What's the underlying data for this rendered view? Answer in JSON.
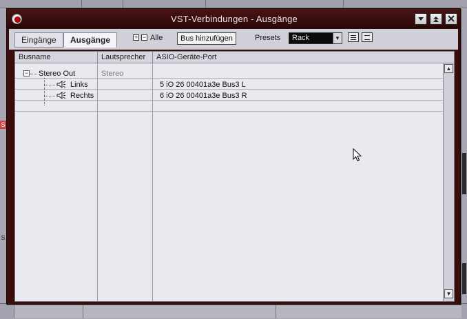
{
  "window": {
    "title": "VST-Verbindungen - Ausgänge",
    "controls": [
      "minimize",
      "maximize",
      "close"
    ]
  },
  "toolbar": {
    "tabs": [
      {
        "label": "Eingänge",
        "active": false
      },
      {
        "label": "Ausgänge",
        "active": true
      }
    ],
    "expand_all": "Alle",
    "add_bus": "Bus hinzufügen",
    "presets_label": "Presets",
    "presets_value": "Rack"
  },
  "table": {
    "columns": [
      "Busname",
      "Lautsprecher",
      "ASIO-Geräte-Port"
    ],
    "rows": [
      {
        "busname": "Stereo Out",
        "lautsprecher": "Stereo",
        "port": ""
      },
      {
        "busname": "Links",
        "lautsprecher": "",
        "port": "5 iO 26 00401a3e Bus3 L"
      },
      {
        "busname": "Rechts",
        "lautsprecher": "",
        "port": "6 iO 26 00401a3e Bus3 R"
      }
    ]
  },
  "background": {
    "left_marks": [
      "S",
      "S"
    ]
  },
  "colors": {
    "titlebar": "#3a0d0d",
    "panel": "#e9eaef",
    "presets_bg": "#0b0b0b"
  }
}
